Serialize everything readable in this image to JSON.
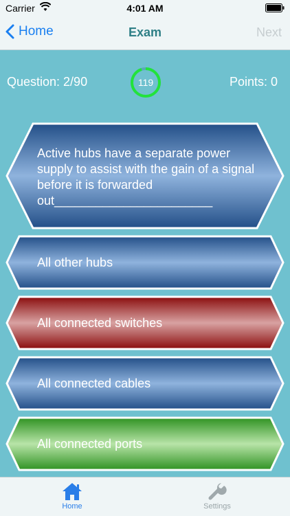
{
  "status_bar": {
    "carrier": "Carrier",
    "time": "4:01 AM"
  },
  "nav": {
    "back_label": "Home",
    "title": "Exam",
    "next_label": "Next"
  },
  "info": {
    "question_label": "Question: 2/90",
    "timer_value": "119",
    "timer_progress": 0.95,
    "points_label": "Points: 0"
  },
  "question": {
    "text": "Active hubs have a separate power supply to assist with the gain of a signal before it is forwarded out_______________________"
  },
  "answers": [
    {
      "text": "All other hubs",
      "state": "default"
    },
    {
      "text": "All connected switches",
      "state": "wrong"
    },
    {
      "text": "All connected cables",
      "state": "default"
    },
    {
      "text": "All connected ports",
      "state": "correct"
    }
  ],
  "colors": {
    "blue": "#2f67a3",
    "red": "#9a1010",
    "green": "#3da42a",
    "timer_ring": "#22e33b",
    "accent": "#1a7ff0",
    "title": "#2e7f86"
  },
  "tabs": [
    {
      "label": "Home",
      "icon": "home-icon",
      "active": true
    },
    {
      "label": "Settings",
      "icon": "wrench-icon",
      "active": false
    }
  ]
}
